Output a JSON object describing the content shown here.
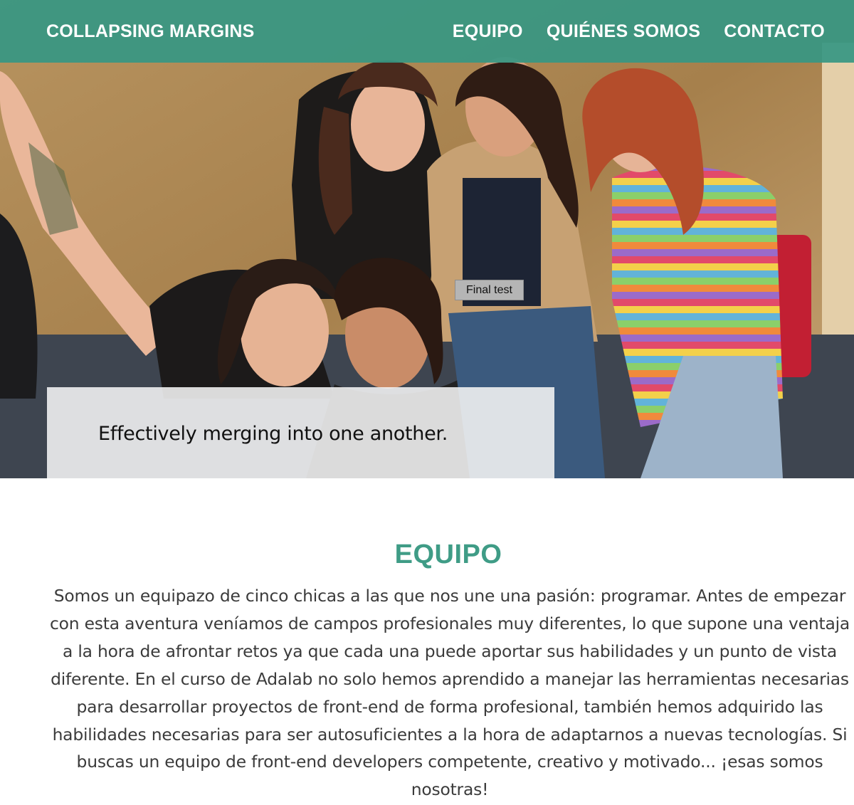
{
  "header": {
    "brand": "COLLAPSING MARGINS",
    "nav": [
      "EQUIPO",
      "QUIÉNES SOMOS",
      "CONTACTO"
    ]
  },
  "hero": {
    "tooltip": "Final test",
    "caption": "Effectively merging into one another."
  },
  "team": {
    "title": "EQUIPO",
    "description": "Somos un equipazo de cinco chicas a las que nos une una pasión: programar. Antes de empezar con esta aventura veníamos de campos profesionales muy diferentes, lo que supone una ventaja a la hora de afrontar retos ya que cada una puede aportar sus habilidades y un punto de vista diferente. En el curso de Adalab no solo hemos aprendido a manejar las herramientas necesarias para desarrollar proyectos de front-end de forma profesional, también hemos adquirido las habilidades necesarias para ser autosuficientes a la hora de adaptarnos a nuevas tecnologías. Si buscas un equipo de front-end developers competente, creativo y motivado... ¡esas somos nosotras!"
  },
  "colors": {
    "header_bg": "#369783",
    "title": "#3f9c86",
    "text": "#3b3b3b"
  }
}
